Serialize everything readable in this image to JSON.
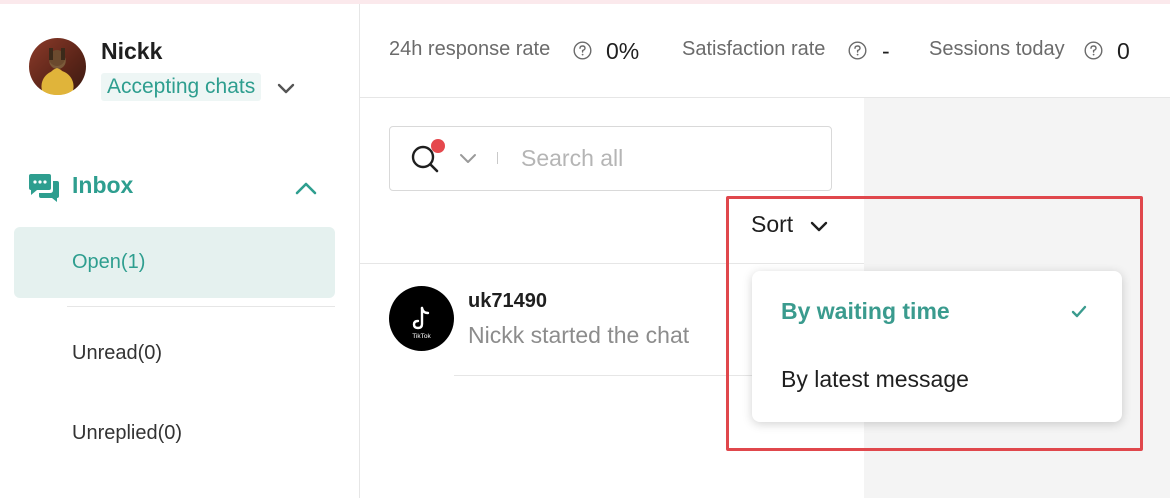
{
  "agent": {
    "name": "Nickk",
    "status": "Accepting chats"
  },
  "sidebar": {
    "section_label": "Inbox",
    "items": [
      {
        "label": "Open(1)",
        "active": true
      },
      {
        "label": "Unread(0)",
        "active": false
      },
      {
        "label": "Unreplied(0)",
        "active": false
      }
    ]
  },
  "stats": {
    "response_rate": {
      "label": "24h response rate",
      "value": "0%"
    },
    "satisfaction": {
      "label": "Satisfaction rate",
      "value": "-"
    },
    "sessions": {
      "label": "Sessions today",
      "value": "0"
    }
  },
  "search": {
    "placeholder": "Search all"
  },
  "sort": {
    "label": "Sort",
    "options": [
      {
        "label": "By waiting time",
        "selected": true
      },
      {
        "label": "By latest message",
        "selected": false
      }
    ]
  },
  "chats": [
    {
      "name": "uk71490",
      "preview": "Nickk started the chat",
      "avatar_text": "TikTok"
    }
  ],
  "colors": {
    "accent": "#2e9e8f",
    "highlight_border": "#e0474c",
    "notification_dot": "#e5484d"
  }
}
